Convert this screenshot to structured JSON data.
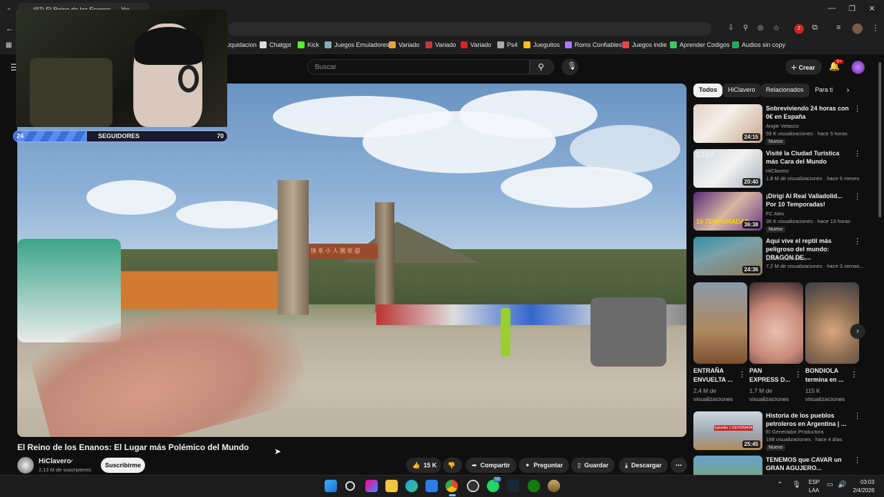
{
  "browser": {
    "tab_title": "(97) El Reino de los Enanos... - YouTube",
    "bookmarks": [
      {
        "label": "Liquidacion",
        "color": "#4a8"
      },
      {
        "label": "Chatgpt",
        "color": "#ddd"
      },
      {
        "label": "Kick",
        "color": "#53fc18"
      },
      {
        "label": "Juegos Emuladores",
        "color": "#8ab"
      },
      {
        "label": "Variado",
        "color": "#e8a33d"
      },
      {
        "label": "Variado",
        "color": "#c33"
      },
      {
        "label": "Variado",
        "color": "#d22"
      },
      {
        "label": "Ps4",
        "color": "#aaa"
      },
      {
        "label": "Jueguitos",
        "color": "#f5c518"
      },
      {
        "label": "Roms Confiables",
        "color": "#a7f"
      },
      {
        "label": "Juegos indie",
        "color": "#e44"
      },
      {
        "label": "Aprender Codigos",
        "color": "#3c6"
      },
      {
        "label": "Audios sin copy",
        "color": "#2a6"
      }
    ],
    "extension_badge": "2"
  },
  "youtube": {
    "search_placeholder": "Buscar",
    "create_label": "Crear",
    "notif_badge": "9+"
  },
  "overlay": {
    "followers_label": "SEGUIDORES",
    "followers_current": "24",
    "followers_goal": "70",
    "progress": 0.343
  },
  "video": {
    "title": "El Reino de los Enanos: El Lugar más Polémico del Mundo",
    "channel": "HiClavero",
    "subscribers": "2,13 M de suscriptores",
    "subscribe_label": "Suscribirme",
    "likes": "15 K",
    "share_label": "Compartir",
    "ask_label": "Preguntar",
    "save_label": "Guardar",
    "download_label": "Descargar",
    "gate_sign": "快 乐 小 人 国 欢 迎"
  },
  "chips": [
    "Todos",
    "HiClavero",
    "Relacionados",
    "Para ti"
  ],
  "recommendations": [
    {
      "title": "Sobreviviendo 24 horas con 0€ en España",
      "channel": "Angie Velasco",
      "meta": "59 K visualizaciones · hace 5 horas",
      "duration": "24:15",
      "badge": "Nuevo"
    },
    {
      "title": "Visité la Ciudad Turística más Cara del Mundo",
      "channel": "HiClavero",
      "meta": "1,8 M de visualizaciones · hace 6 meses",
      "duration": "20:40",
      "badge": "",
      "thumb_text": "$350"
    },
    {
      "title": "¡Dirigí Al Real Valladolid... Por 10 Temporadas!",
      "channel": "FC Alex",
      "meta": "36 K visualizaciones · hace 13 horas",
      "duration": "36:38",
      "badge": "Nuevo",
      "thumb_text": "10 TEMPORADAS"
    },
    {
      "title": "Aquí vive el reptil más peligroso del mundo: DRAGÓN DE ...",
      "channel": "Luisito Comunica",
      "meta": "7,2 M de visualizaciones · hace 3 seman...",
      "duration": "24:36",
      "badge": ""
    }
  ],
  "shorts": [
    {
      "title": "ENTRAÑA ENVUELTA ...",
      "views": "2,4 M de visualizaciones"
    },
    {
      "title": "PAN EXPRESS D...",
      "views": "1,7 M de visualizaciones"
    },
    {
      "title": "BONDIOLA termina en ...",
      "views": "115 K visualizaciones"
    }
  ],
  "more_recs": [
    {
      "title": "Historia de los pueblos petroleros en Argentina | ...",
      "channel": "El Generador Productora",
      "meta": "198 visualizaciones · hace 4 días",
      "duration": "25:45",
      "badge": "Nuevo",
      "thumb_text": "Episodio 1 GEOGRAFÍA"
    },
    {
      "title": "TENEMOS que CAVAR un GRAN AGUJERO...",
      "channel": "",
      "meta": "",
      "duration": "",
      "badge": ""
    }
  ],
  "taskbar": {
    "lang": "ESP",
    "lang2": "LAA",
    "time": "03:03",
    "date": "2/4/2026",
    "badge": "59"
  }
}
